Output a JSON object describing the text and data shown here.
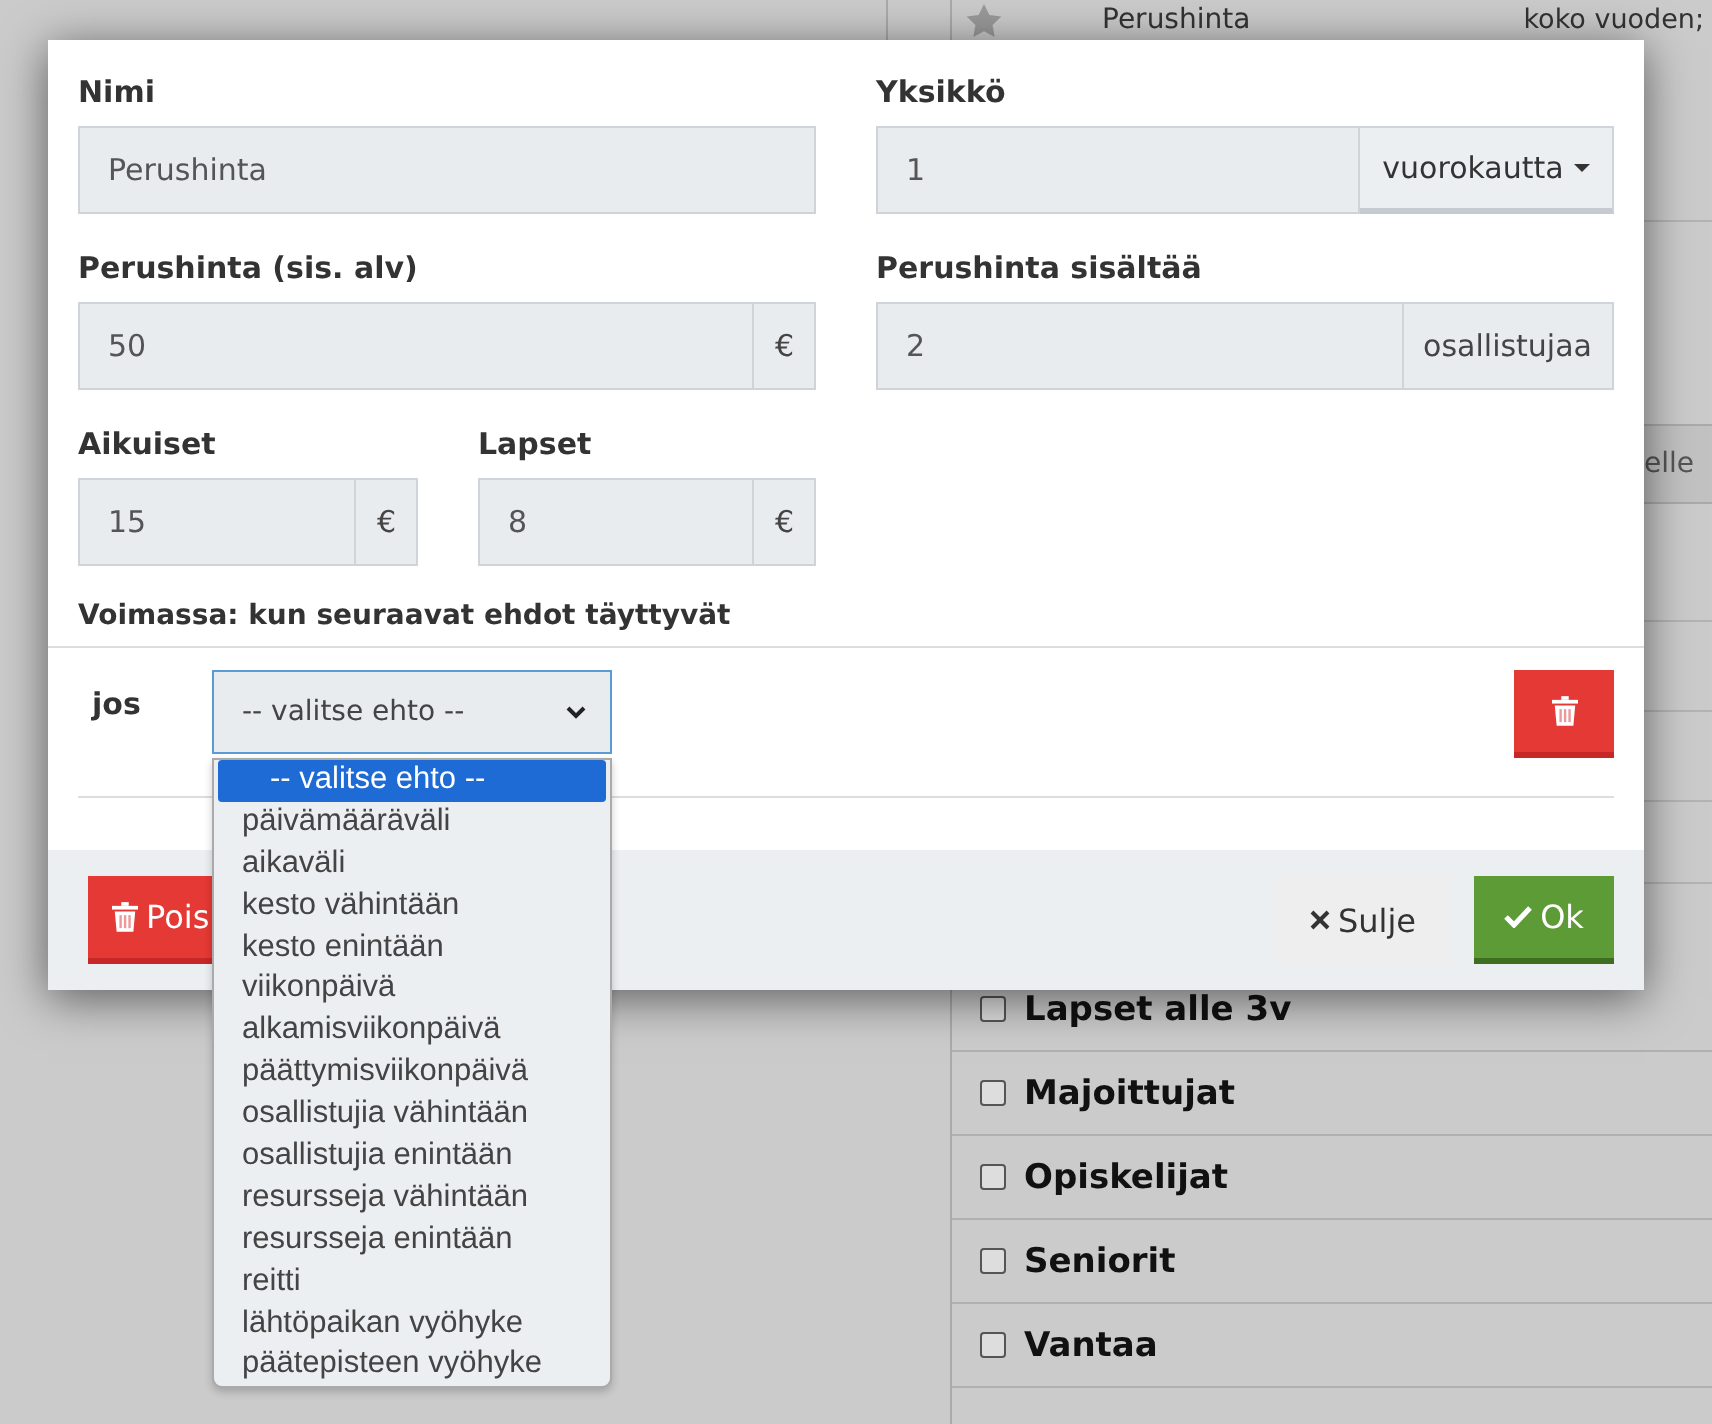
{
  "background": {
    "top_row": {
      "name": "Perushinta",
      "period": "koko vuoden;"
    },
    "side_button": "elle",
    "groups": [
      {
        "label": "Lapset alle 3v",
        "checked": false
      },
      {
        "label": "Majoittujat",
        "checked": false
      },
      {
        "label": "Opiskelijat",
        "checked": false
      },
      {
        "label": "Seniorit",
        "checked": false
      },
      {
        "label": "Vantaa",
        "checked": false
      }
    ]
  },
  "modal": {
    "fields": [
      {
        "kind": "plain",
        "label": "Nimi",
        "value": "Perushinta"
      },
      {
        "kind": "dropdown",
        "label": "Yksikkö",
        "value": "1",
        "addon": "vuorokautta"
      },
      {
        "kind": "addon",
        "label": "Perushinta (sis. alv)",
        "value": "50",
        "addon": "€"
      },
      {
        "kind": "addon",
        "label": "Perushinta sisältää",
        "value": "2",
        "addon": "osallistujaa"
      },
      {
        "kind": "addon",
        "label": "Aikuiset",
        "value": "15",
        "addon": "€"
      },
      {
        "kind": "addon",
        "label": "Lapset",
        "value": "8",
        "addon": "€"
      }
    ],
    "validity_heading": "Voimassa: kun seuraavat ehdot täyttyvät",
    "condition": {
      "prefix": "jos",
      "select_value": "-- valitse ehto --",
      "options": [
        {
          "label": "-- valitse ehto --",
          "selected": true
        },
        {
          "label": "päivämääräväli",
          "selected": false
        },
        {
          "label": "aikaväli",
          "selected": false
        },
        {
          "label": "kesto vähintään",
          "selected": false
        },
        {
          "label": "kesto enintään",
          "selected": false
        },
        {
          "label": "viikonpäivä",
          "selected": false
        },
        {
          "label": "alkamisviikonpäivä",
          "selected": false
        },
        {
          "label": "päättymisviikonpäivä",
          "selected": false
        },
        {
          "label": "osallistujia vähintään",
          "selected": false
        },
        {
          "label": "osallistujia enintään",
          "selected": false
        },
        {
          "label": "resursseja vähintään",
          "selected": false
        },
        {
          "label": "resursseja enintään",
          "selected": false
        },
        {
          "label": "reitti",
          "selected": false
        },
        {
          "label": "lähtöpaikan vyöhyke",
          "selected": false
        },
        {
          "label": "päätepisteen vyöhyke",
          "selected": false
        }
      ]
    },
    "footer": {
      "delete": "Pois",
      "close": "Sulje",
      "ok": "Ok"
    }
  }
}
